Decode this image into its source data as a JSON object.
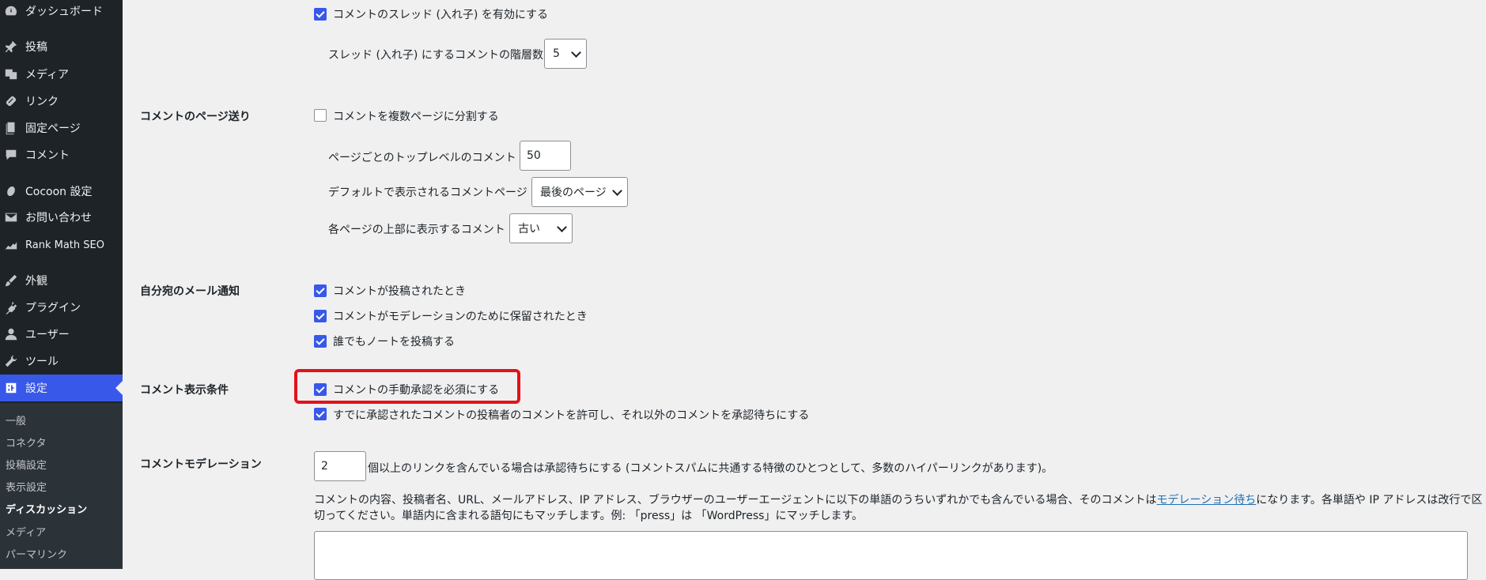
{
  "sidebar": {
    "items": [
      {
        "label": "ダッシュボード",
        "icon": "dashboard-icon"
      },
      {
        "label": "投稿",
        "icon": "pin-icon"
      },
      {
        "label": "メディア",
        "icon": "media-icon"
      },
      {
        "label": "リンク",
        "icon": "link-icon"
      },
      {
        "label": "固定ページ",
        "icon": "pages-icon"
      },
      {
        "label": "コメント",
        "icon": "comment-icon"
      },
      {
        "label": "Cocoon 設定",
        "icon": "cocoon-icon"
      },
      {
        "label": "お問い合わせ",
        "icon": "mail-icon"
      },
      {
        "label": "Rank Math SEO",
        "icon": "rankmath-icon"
      },
      {
        "label": "外観",
        "icon": "brush-icon"
      },
      {
        "label": "プラグイン",
        "icon": "plugin-icon"
      },
      {
        "label": "ユーザー",
        "icon": "user-icon"
      },
      {
        "label": "ツール",
        "icon": "wrench-icon"
      },
      {
        "label": "設定",
        "icon": "settings-icon"
      }
    ],
    "submenu": [
      "一般",
      "コネクタ",
      "投稿設定",
      "表示設定",
      "ディスカッション",
      "メディア",
      "パーマリンク"
    ]
  },
  "threaded": {
    "checkbox_label": "コメントのスレッド (入れ子) を有効にする",
    "depth_label": "スレッド (入れ子) にするコメントの階層数",
    "depth_value": "5"
  },
  "paging": {
    "row_label": "コメントのページ送り",
    "checkbox_label": "コメントを複数ページに分割する",
    "top_level_label": "ページごとのトップレベルのコメント",
    "top_level_value": "50",
    "default_page_label": "デフォルトで表示されるコメントページ",
    "default_page_value": "最後のページ",
    "order_label": "各ページの上部に表示するコメント",
    "order_value": "古い"
  },
  "email": {
    "row_label": "自分宛のメール通知",
    "options": [
      "コメントが投稿されたとき",
      "コメントがモデレーションのために保留されたとき",
      "誰でもノートを投稿する"
    ]
  },
  "appear": {
    "row_label": "コメント表示条件",
    "options": [
      "コメントの手動承認を必須にする",
      "すでに承認されたコメントの投稿者のコメントを許可し、それ以外のコメントを承認待ちにする"
    ]
  },
  "moderation": {
    "row_label": "コメントモデレーション",
    "links_value": "2",
    "links_text": "個以上のリンクを含んでいる場合は承認待ちにする (コメントスパムに共通する特徴のひとつとして、多数のハイパーリンクがあります)。",
    "desc_part1": "コメントの内容、投稿者名、URL、メールアドレス、IP アドレス、ブラウザーのユーザーエージェントに以下の単語のうちいずれかでも含んでいる場合、そのコメントは",
    "desc_link": "モデレーション待ち",
    "desc_part2": "になります。各単語や IP アドレスは改行で区",
    "desc_line2": "切ってください。単語内に含まれる語句にもマッチします。例: 「press」は 「WordPress」にマッチします。"
  }
}
